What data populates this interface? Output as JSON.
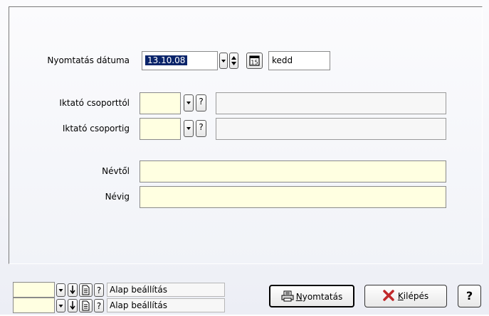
{
  "form": {
    "print_date": {
      "label": "Nyomtatás dátuma",
      "value": "13.10.08",
      "day_name": "kedd"
    },
    "group_from": {
      "label": "Iktató csoporttól",
      "value": "",
      "help": "?"
    },
    "group_to": {
      "label": "Iktató csoportig",
      "value": "",
      "help": "?"
    },
    "name_from": {
      "label": "Névtől",
      "value": ""
    },
    "name_to": {
      "label": "Névig",
      "value": ""
    },
    "calendar_glyph": "15"
  },
  "footer": {
    "rows": [
      {
        "help": "?",
        "status": "Alap beállítás"
      },
      {
        "help": "?",
        "status": "Alap beállítás"
      }
    ],
    "print_button": {
      "label": "Nyomtatás",
      "mnemonic": "N",
      "rest": "yomtatás"
    },
    "exit_button": {
      "label": "Kilépés",
      "mnemonic": "K",
      "rest": "ilépés"
    },
    "help_button": "?"
  },
  "icons": [
    "dropdown-arrow-icon",
    "spin-updown-icon",
    "calendar-icon",
    "download-arrow-icon",
    "document-icon",
    "printer-icon",
    "close-x-icon"
  ],
  "colors": {
    "field_bg": "#ffffe1",
    "selection": "#0a246a",
    "exit_icon": "#c0282a"
  }
}
